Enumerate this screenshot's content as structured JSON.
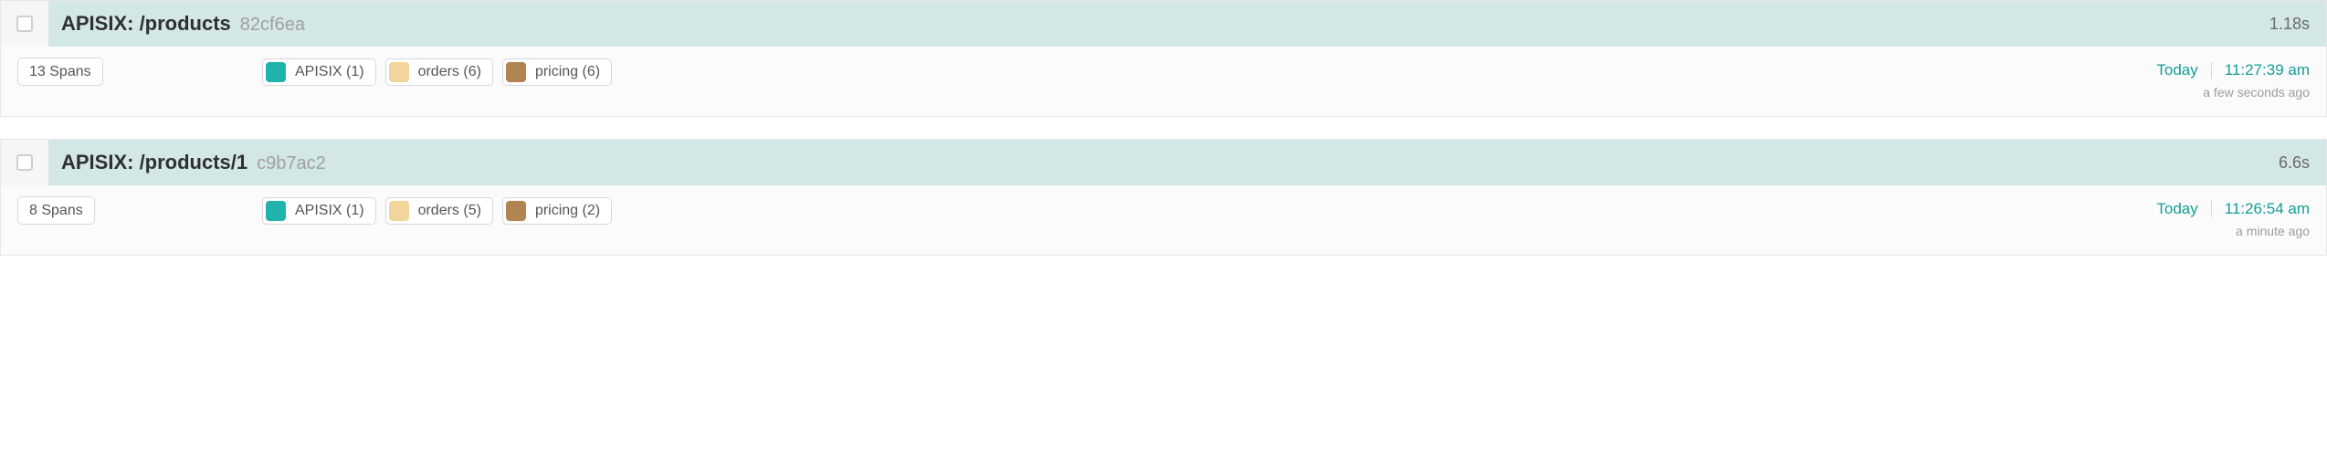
{
  "colors": {
    "teal": "#149d96",
    "swatch_apisix": "#1fb3ac",
    "swatch_orders": "#f2d59a",
    "swatch_pricing": "#b18452"
  },
  "traces": [
    {
      "highlighted": true,
      "title": "APISIX: /products",
      "trace_id": "82cf6ea",
      "duration": "1.18s",
      "spans_label": "13 Spans",
      "services": [
        {
          "name": "APISIX (1)",
          "color_key": "swatch_apisix"
        },
        {
          "name": "orders (6)",
          "color_key": "swatch_orders"
        },
        {
          "name": "pricing (6)",
          "color_key": "swatch_pricing"
        }
      ],
      "time_day": "Today",
      "time_clock": "11:27:39 am",
      "time_ago": "a few seconds ago"
    },
    {
      "highlighted": true,
      "title": "APISIX: /products/1",
      "trace_id": "c9b7ac2",
      "duration": "6.6s",
      "spans_label": "8 Spans",
      "services": [
        {
          "name": "APISIX (1)",
          "color_key": "swatch_apisix"
        },
        {
          "name": "orders (5)",
          "color_key": "swatch_orders"
        },
        {
          "name": "pricing (2)",
          "color_key": "swatch_pricing"
        }
      ],
      "time_day": "Today",
      "time_clock": "11:26:54 am",
      "time_ago": "a minute ago"
    }
  ]
}
